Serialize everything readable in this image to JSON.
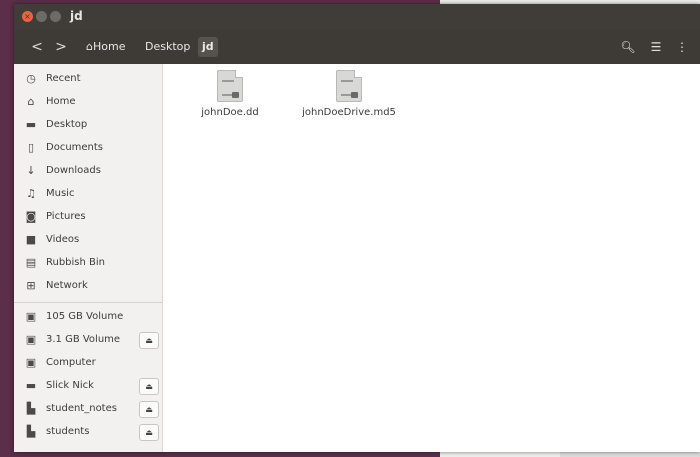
{
  "window": {
    "title": "jd"
  },
  "toolbar": {
    "back_icon": "<",
    "forward_icon": ">",
    "breadcrumbs": [
      {
        "label": "Home",
        "icon": "home-icon"
      },
      {
        "label": "Desktop"
      },
      {
        "label": "jd"
      }
    ]
  },
  "sidebar": {
    "places": [
      {
        "label": "Recent",
        "icon": "clock-icon"
      },
      {
        "label": "Home",
        "icon": "home-icon"
      },
      {
        "label": "Desktop",
        "icon": "folder-icon"
      },
      {
        "label": "Documents",
        "icon": "document-icon"
      },
      {
        "label": "Downloads",
        "icon": "download-icon"
      },
      {
        "label": "Music",
        "icon": "music-icon"
      },
      {
        "label": "Pictures",
        "icon": "camera-icon"
      },
      {
        "label": "Videos",
        "icon": "video-icon"
      },
      {
        "label": "Rubbish Bin",
        "icon": "trash-icon"
      },
      {
        "label": "Network",
        "icon": "network-icon"
      }
    ],
    "devices": [
      {
        "label": "105 GB Volume",
        "icon": "drive-icon",
        "eject": false
      },
      {
        "label": "3.1 GB Volume",
        "icon": "drive-icon",
        "eject": true
      },
      {
        "label": "Computer",
        "icon": "drive-icon",
        "eject": false
      },
      {
        "label": "Slick Nick",
        "icon": "usb-drive-icon",
        "eject": true
      },
      {
        "label": "student_notes",
        "icon": "network-drive-icon",
        "eject": true
      },
      {
        "label": "students",
        "icon": "network-drive-icon",
        "eject": true
      }
    ]
  },
  "files": [
    {
      "name": "johnDoe.dd"
    },
    {
      "name": "johnDoeDrive.md5"
    }
  ]
}
